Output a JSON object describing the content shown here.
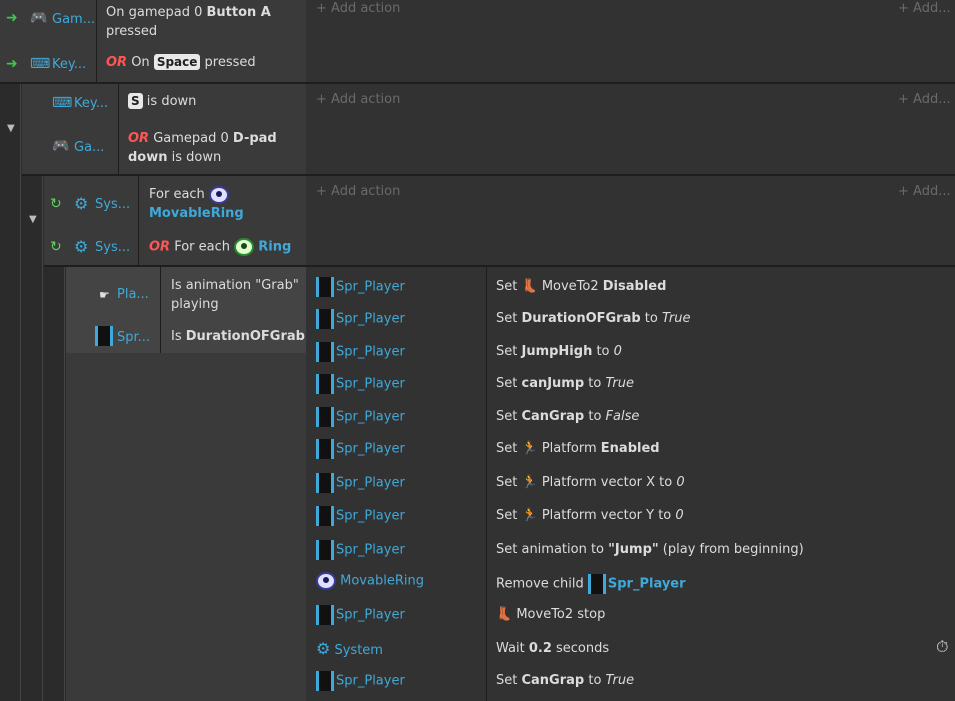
{
  "event1": {
    "conditions": [
      {
        "obj": "Gam...",
        "text1": "On gamepad 0 ",
        "bold1": "Button A",
        "text2": "pressed"
      },
      {
        "obj": "Key...",
        "or": "OR",
        "text1": "On ",
        "key": "Space",
        "text2": "pressed"
      }
    ],
    "add_action": "+ Add action",
    "add_short": "+ Add..."
  },
  "event2": {
    "conditions": [
      {
        "obj": "Key...",
        "key": "S",
        "text1": "is down"
      },
      {
        "obj": "Ga...",
        "or": "OR",
        "text1": "Gamepad 0 ",
        "bold1": "D-pad",
        "bold2": "down",
        "text2": "is down"
      }
    ],
    "add_action": "+ Add action",
    "add_short": "+ Add..."
  },
  "event3": {
    "conditions": [
      {
        "obj": "Sys...",
        "text1": "For each",
        "bold1": "MovableRing"
      },
      {
        "obj": "Sys...",
        "or": "OR",
        "text1": "For each",
        "bold1": "Ring"
      }
    ],
    "add_action": "+ Add action",
    "add_short": "+ Add..."
  },
  "event4": {
    "conditions": [
      {
        "obj": "Pla...",
        "text1": "Is animation \"Grab\"",
        "text2": "playing"
      },
      {
        "obj": "Spr...",
        "text1": "Is ",
        "bold1": "DurationOFGrab"
      }
    ],
    "actions": [
      {
        "obj": "Spr_Player",
        "pre": "Set ",
        "icon": "boot",
        "mid": "MoveTo2 ",
        "bold": "Disabled",
        "post": "",
        "ital": ""
      },
      {
        "obj": "Spr_Player",
        "pre": "Set ",
        "icon": "",
        "mid": "",
        "bold": "DurationOFGrab",
        "post": " to ",
        "ital": "True"
      },
      {
        "obj": "Spr_Player",
        "pre": "Set ",
        "icon": "",
        "mid": "",
        "bold": "JumpHigh",
        "post": " to ",
        "ital": "0"
      },
      {
        "obj": "Spr_Player",
        "pre": "Set ",
        "icon": "",
        "mid": "",
        "bold": "canJump",
        "post": " to ",
        "ital": "True"
      },
      {
        "obj": "Spr_Player",
        "pre": "Set ",
        "icon": "",
        "mid": "",
        "bold": "CanGrap",
        "post": " to ",
        "ital": "False"
      },
      {
        "obj": "Spr_Player",
        "pre": "Set ",
        "icon": "runner",
        "mid": "Platform ",
        "bold": "Enabled",
        "post": "",
        "ital": ""
      },
      {
        "obj": "Spr_Player",
        "pre": "Set ",
        "icon": "runner",
        "mid": "Platform vector X to ",
        "bold": "",
        "post": "",
        "ital": "0"
      },
      {
        "obj": "Spr_Player",
        "pre": "Set ",
        "icon": "runner",
        "mid": "Platform vector Y to ",
        "bold": "",
        "post": "",
        "ital": "0"
      },
      {
        "obj": "Spr_Player",
        "pre": "Set animation to ",
        "icon": "",
        "mid": "",
        "bold": "\"Jump\"",
        "post": " (play from beginning)",
        "ital": ""
      },
      {
        "obj": "MovableRing",
        "pre": "Remove child ",
        "icon": "",
        "mid": "",
        "bold": "Spr_Player",
        "post": "",
        "ital": ""
      },
      {
        "obj": "Spr_Player",
        "pre": "",
        "icon": "boot",
        "mid": "MoveTo2 stop",
        "bold": "",
        "post": "",
        "ital": ""
      },
      {
        "obj": "System",
        "pre": "Wait ",
        "icon": "",
        "mid": "",
        "bold": "0.2",
        "post": " seconds",
        "ital": ""
      },
      {
        "obj": "Spr_Player",
        "pre": "Set ",
        "icon": "",
        "mid": "",
        "bold": "CanGrap",
        "post": " to ",
        "ital": "True"
      }
    ]
  },
  "icons": {
    "trigger": "trigger-arrow-icon",
    "gamepad": "gamepad-icon",
    "keyboard": "keyboard-icon",
    "system": "gear-icon",
    "loop": "loop-icon",
    "sprite": "sprite-icon",
    "ring": "eye-icon",
    "timer": "stopwatch-icon",
    "collapse": "chevron-down-icon"
  },
  "colors": {
    "background": "#2b2b2b",
    "object": "#3fa9d9",
    "or": "#ff5555",
    "trigger": "#3cc84a"
  }
}
